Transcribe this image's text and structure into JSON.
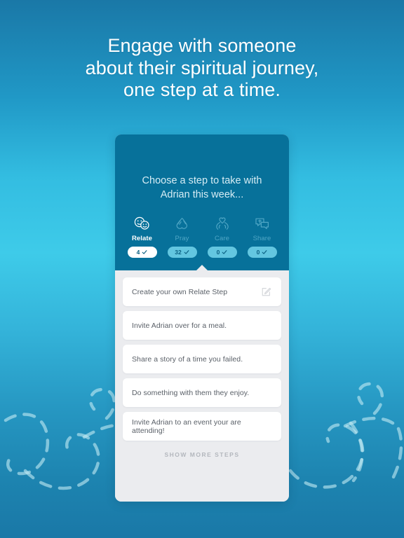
{
  "headline": {
    "line1": "Engage with someone",
    "line2": "about their spiritual journey,",
    "line3": "one step at a time."
  },
  "card": {
    "title": {
      "line1": "Choose a step to take with",
      "line2": "Adrian this week..."
    },
    "tabs": [
      {
        "label": "Relate",
        "icon": "relate-faces-icon",
        "count": "4",
        "check": "✓",
        "active": true
      },
      {
        "label": "Pray",
        "icon": "praying-hands-icon",
        "count": "32",
        "check": "✓",
        "active": false
      },
      {
        "label": "Care",
        "icon": "heart-hands-icon",
        "count": "0",
        "check": "✓",
        "active": false
      },
      {
        "label": "Share",
        "icon": "speech-bubbles-cross-icon",
        "count": "0",
        "check": "✓",
        "active": false
      }
    ],
    "steps": [
      {
        "text": "Create your own Relate Step",
        "action_icon": "edit-pencil-square-icon"
      },
      {
        "text": "Invite Adrian over for a meal.",
        "action_icon": ""
      },
      {
        "text": "Share a story of a time you failed.",
        "action_icon": ""
      },
      {
        "text": "Do something with them they enjoy.",
        "action_icon": ""
      },
      {
        "text": "Invite Adrian to an event your are attending!",
        "action_icon": ""
      }
    ],
    "show_more_label": "SHOW MORE STEPS"
  },
  "colors": {
    "background_top": "#1a78a7",
    "background_mid": "#3ecbe9",
    "background_bottom": "#1a78a7",
    "card_header": "#07719a",
    "card_body": "#ebecef",
    "badge_inactive": "#63c6e0",
    "badge_active": "#ffffff",
    "tab_label_inactive": "#4fa6c5",
    "step_text": "#5a6068",
    "show_more_text": "#b3b7bd"
  }
}
